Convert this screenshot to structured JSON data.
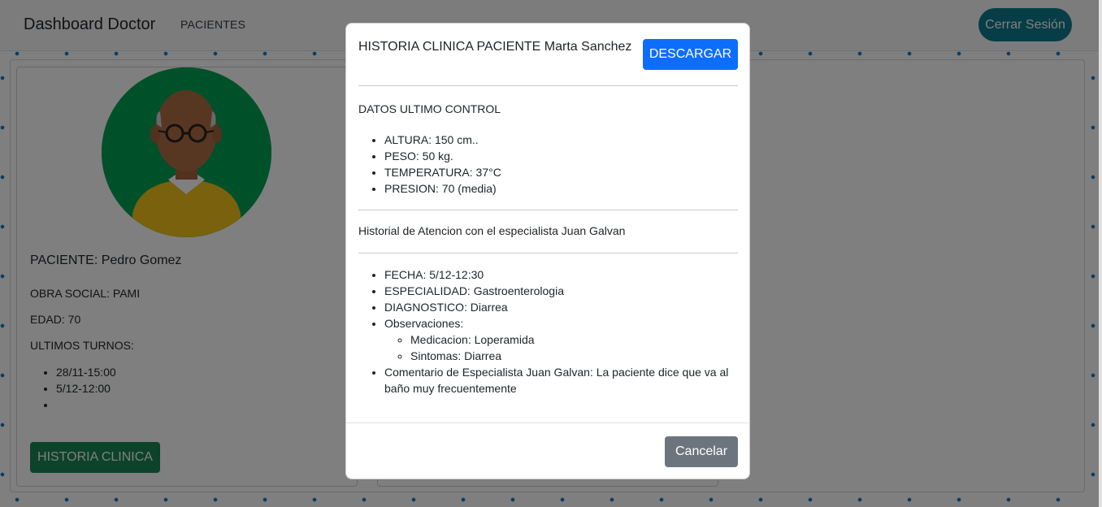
{
  "navbar": {
    "brand": "Dashboard Doctor",
    "link_pacientes": "PACIENTES",
    "logout": "Cerrar Sesión"
  },
  "patient": {
    "name": "PACIENTE: Pedro Gomez",
    "obra_social": "OBRA SOCIAL: PAMI",
    "edad": "EDAD: 70",
    "ultimos_turnos_label": "ULTIMOS TURNOS:",
    "turnos": [
      "28/11-15:00",
      "5/12-12:00",
      ""
    ],
    "historia_button": "HISTORIA CLINICA"
  },
  "modal": {
    "title": "HISTORIA CLINICA PACIENTE Marta Sanchez",
    "download_button": "DESCARGAR",
    "control_title": "DATOS ULTIMO CONTROL",
    "control_items": [
      "ALTURA: 150 cm..",
      "PESO: 50 kg.",
      "TEMPERATURA: 37°C",
      "PRESION: 70 (media)"
    ],
    "historial_title": "Historial de Atencion con el especialista Juan Galvan",
    "atencion": {
      "fecha": "FECHA: 5/12-12:30",
      "especialidad": "ESPECIALIDAD: Gastroenterologia",
      "diagnostico": "DIAGNOSTICO: Diarrea",
      "observaciones_label": "Observaciones:",
      "observaciones": [
        "Medicacion: Loperamida",
        "Sintomas: Diarrea"
      ],
      "comentario": "Comentario de Especialista Juan Galvan: La paciente dice que va al baño muy frecuentemente"
    },
    "cancel_button": "Cancelar"
  },
  "colors": {
    "primary": "#0d6efd",
    "success": "#198754",
    "secondary": "#6c757d",
    "logout": "#0f7a8c",
    "avatar_bg": "#00a352"
  }
}
